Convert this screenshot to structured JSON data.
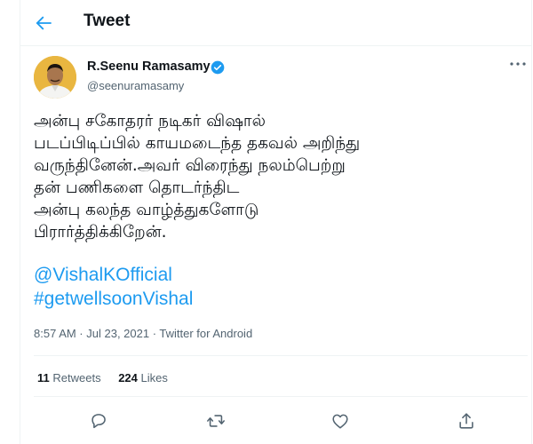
{
  "header": {
    "title": "Tweet"
  },
  "author": {
    "name": "R.Seenu Ramasamy",
    "handle": "@seenuramasamy",
    "verified": true
  },
  "tweet": {
    "lines": [
      "அன்பு சகோதரர் நடிகர் விஷால்",
      "படப்பிடிப்பில் காயமடைந்த தகவல் அறிந்து",
      "வருந்தினேன்.அவர் விரைந்து நலம்பெற்று",
      "தன் பணிகளை தொடர்ந்திட",
      "அன்பு கலந்த வாழ்த்துகளோடு",
      "பிரார்த்திக்கிறேன்."
    ],
    "mention": "@VishalKOfficial",
    "hashtag": "#getwellsoonVishal"
  },
  "meta": "8:57 AM · Jul 23, 2021 · Twitter for Android",
  "stats": {
    "retweets_count": "11",
    "retweets_label": "Retweets",
    "likes_count": "224",
    "likes_label": "Likes"
  },
  "icons": {
    "back": "arrow-left-icon",
    "verified": "verified-badge-icon",
    "more": "more-dots-icon",
    "reply": "reply-icon",
    "retweet": "retweet-icon",
    "like": "heart-icon",
    "share": "share-icon"
  },
  "colors": {
    "accent": "#1d9bf0",
    "text": "#0f1419",
    "secondary": "#536471",
    "border": "#eff3f4"
  }
}
